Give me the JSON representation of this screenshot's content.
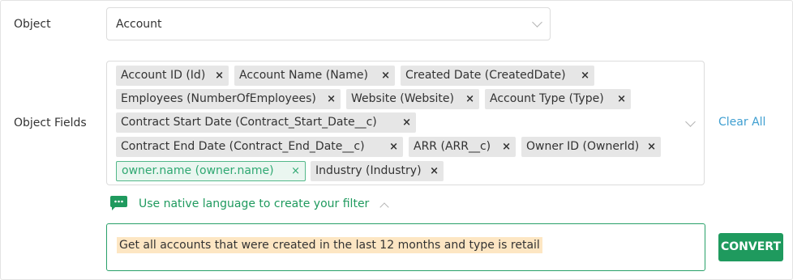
{
  "object": {
    "label": "Object",
    "value": "Account"
  },
  "object_fields": {
    "label": "Object Fields",
    "chips": [
      {
        "text": "Account ID (Id)"
      },
      {
        "text": "Account Name (Name)"
      },
      {
        "text": "Created Date (CreatedDate)"
      },
      {
        "text": "Employees (NumberOfEmployees)"
      },
      {
        "text": "Website (Website)"
      },
      {
        "text": "Account Type (Type)"
      },
      {
        "text": "Contract Start Date (Contract_Start_Date__c)"
      },
      {
        "text": "Contract End Date (Contract_End_Date__c)"
      },
      {
        "text": "ARR (ARR__c)"
      },
      {
        "text": "Owner ID (OwnerId)"
      },
      {
        "text": "owner.name (owner.name)"
      },
      {
        "text": "Industry (Industry)"
      }
    ],
    "remove_glyph": "×",
    "clear_all": "Clear All"
  },
  "native_language": {
    "icon": "chat-bubble-icon",
    "text": "Use native language to create your filter"
  },
  "prompt": {
    "text": "Get all accounts that were created in the last 12 months and type is retail"
  },
  "convert_button": "CONVERT",
  "colors": {
    "accent_green": "#1f9a5e",
    "link_blue": "#3f9fd1",
    "highlight": "#fde6c3",
    "chip_bg": "#e6e6e6"
  }
}
